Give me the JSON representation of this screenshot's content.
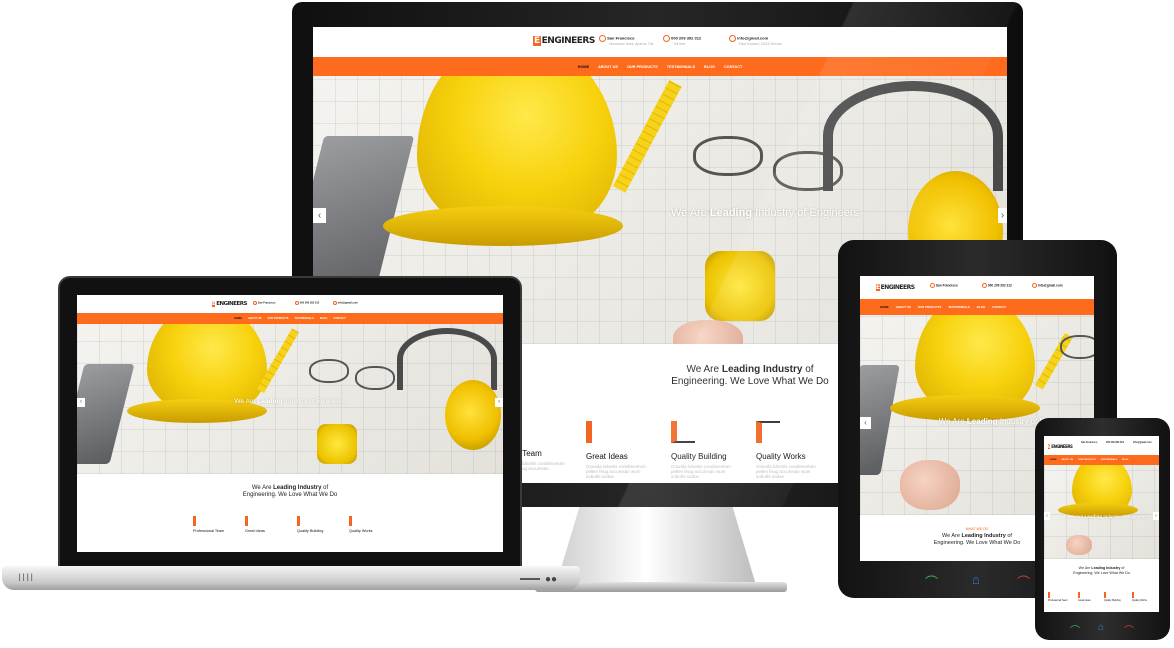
{
  "brand": {
    "logo": "ENGINEERS",
    "logo_mark": "E",
    "accent": "#fe6b1d",
    "dark": "#111111"
  },
  "header": {
    "location_title": "San Francisco",
    "location_sub": "Nouveaux Hara, Aparna, Ctz",
    "phone_title": "000 209 392 312",
    "phone_sub": "Toll free",
    "email_title": "info@gmail.com",
    "email_sub": "Fast Contact, 24/24 Service"
  },
  "nav": [
    "HOME",
    "ABOUT US",
    "OUR PRODUCTS",
    "TESTIMONIALS",
    "BLOG",
    "CONTACT"
  ],
  "hero": {
    "prefix": "We Are",
    "highlight": "Leading",
    "suffix": "Industry of Engineers",
    "prev": "‹",
    "next": "›"
  },
  "about": {
    "kicker": "WHAT WE DO",
    "line1_prefix": "We Are",
    "line1_highlight": "Leading Industry",
    "line1_suffix": "of",
    "line2": "Engineering. We Love What We Do"
  },
  "features": [
    {
      "title": "Professional Team",
      "icon": "team-icon",
      "desc": "Gravida lobortis condimentum pellen feug accumsan"
    },
    {
      "title": "Great Ideas",
      "icon": "ideas-icon",
      "desc": "Gravida lobortis condimentum pellen feug accumsan wum sobothi sodoe"
    },
    {
      "title": "Quality Building",
      "icon": "building-icon",
      "desc": "Gravida lobortis condimentum pellen feug accumsan wum sobothi sodoe"
    },
    {
      "title": "Quality Works",
      "icon": "works-icon",
      "desc": "Gravida lobortis condimentum pellen feug accumsan wum sobothi sodoe"
    }
  ],
  "monitor_features_visible": {
    "first": "onal Team"
  },
  "tablet_buttons": [
    "call-icon",
    "home-icon",
    "hangup-icon"
  ],
  "laptop": {
    "vents": "IIII"
  }
}
